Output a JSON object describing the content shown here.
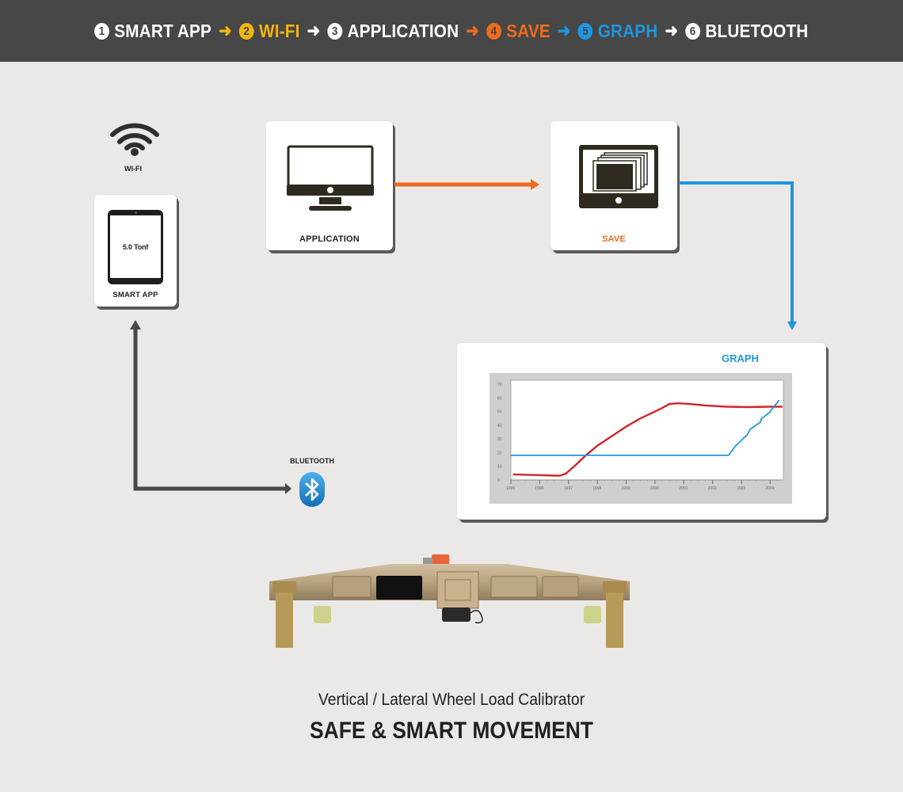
{
  "header": {
    "steps": [
      {
        "number": "1",
        "label": "SMART APP",
        "color": "#ffffff"
      },
      {
        "number": "2",
        "label": "WI-FI",
        "color": "#f2b50f"
      },
      {
        "number": "3",
        "label": "APPLICATION",
        "color": "#ffffff"
      },
      {
        "number": "4",
        "label": "SAVE",
        "color": "#ee6b1f"
      },
      {
        "number": "5",
        "label": "GRAPH",
        "color": "#1e96e0"
      },
      {
        "number": "6",
        "label": "BLUETOOTH",
        "color": "#ffffff"
      }
    ],
    "arrow": "➜",
    "arrow_colors": [
      "#f2b50f",
      "#ffffff",
      "#ee6b1f",
      "#1e96e0",
      "#ffffff"
    ]
  },
  "nodes": {
    "wifi": {
      "label": "WI-FI",
      "icon": "wifi-icon"
    },
    "smart_app": {
      "label": "SMART APP",
      "screen_value": "5.0 Tonf",
      "icon": "tablet-icon"
    },
    "application": {
      "label": "APPLICATION",
      "icon": "monitor-icon"
    },
    "save": {
      "label": "SAVE",
      "icon": "stacked-windows-icon",
      "label_color": "#ee6b1f"
    },
    "graph": {
      "label": "GRAPH",
      "label_color": "#1e96e0"
    },
    "bluetooth": {
      "label": "BLUETOOTH",
      "icon": "bluetooth-icon"
    }
  },
  "connectors": {
    "application_to_save": "#ee6b1f",
    "save_to_graph": "#1e96e0",
    "bluetooth_to_smart_app": "#474747"
  },
  "product": {
    "image": "wheel-load-calibrator-photo",
    "subtitle": "Vertical / Lateral Wheel Load Calibrator",
    "title": "SAFE & SMART MOVEMENT"
  },
  "chart_data": {
    "type": "line",
    "title": "GRAPH",
    "xlabel": "",
    "ylabel": "",
    "xlim": [
      1995,
      2004.4
    ],
    "ylim": [
      0,
      70
    ],
    "x_ticks": [
      "1995",
      "1996",
      "1997",
      "1998",
      "1999",
      "2000",
      "2001",
      "2002",
      "2003",
      "2004"
    ],
    "y_ticks": [
      "0",
      "10",
      "20",
      "30",
      "40",
      "50",
      "60",
      "70"
    ],
    "grid": false,
    "legend": "none",
    "series": [
      {
        "name": "red",
        "color": "#d0262a",
        "x": [
          1995.1,
          1995.5,
          1996.0,
          1996.5,
          1996.7,
          1996.9,
          1997.2,
          1997.6,
          1998.0,
          1998.5,
          1999.0,
          1999.5,
          2000.0,
          2000.2,
          2000.5,
          2000.8,
          2001.2,
          2001.8,
          2002.5,
          2003.2,
          2004.0,
          2004.4
        ],
        "y": [
          4,
          3.8,
          3.5,
          3.2,
          3.2,
          4.5,
          10,
          18,
          25,
          32,
          39,
          45,
          50,
          52,
          55.5,
          56,
          55.5,
          54.3,
          53.5,
          53.2,
          53.5,
          53.5
        ]
      },
      {
        "name": "blue",
        "color": "#1e96e0",
        "x": [
          1995.0,
          1996.0,
          1997.0,
          1998.0,
          1999.0,
          2000.0,
          2001.0,
          2002.0,
          2002.55,
          2002.8,
          2003.0,
          2003.2,
          2003.3,
          2003.5,
          2003.65,
          2003.7,
          2003.9,
          2004.0,
          2004.1,
          2004.3
        ],
        "y": [
          18,
          18,
          18,
          18,
          18,
          18,
          18,
          18,
          18,
          25,
          29,
          33,
          37,
          40,
          42,
          45,
          48,
          50,
          53,
          58
        ]
      }
    ]
  }
}
